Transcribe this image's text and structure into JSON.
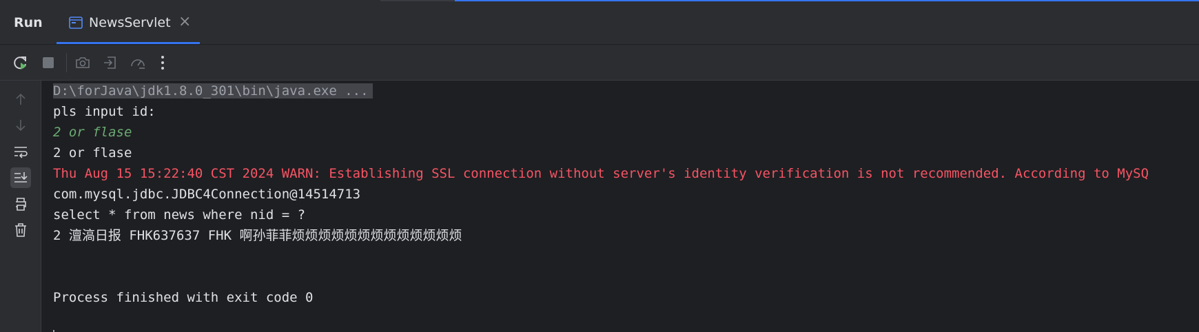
{
  "window": {
    "panel_title": "Run",
    "tab_label": "NewsServlet",
    "tab_close_glyph": "×"
  },
  "toolbar": {
    "buttons": [
      "rerun-icon",
      "stop-icon",
      "camera-icon",
      "exit-icon",
      "profiler-icon",
      "more-icon"
    ]
  },
  "gutter": {
    "buttons": [
      "arrow-up-icon",
      "arrow-down-icon",
      "soft-wrap-icon",
      "scroll-to-end-icon",
      "print-icon",
      "trash-icon"
    ]
  },
  "console": {
    "command": "D:\\forJava\\jdk1.8.0_301\\bin\\java.exe ...",
    "prompt": "pls input id:",
    "user_input": "2 or flase",
    "echo": "2 or flase",
    "warning": "Thu Aug 15 15:22:40 CST 2024 WARN: Establishing SSL connection without server's identity verification is not recommended. According to MySQ",
    "connection": "com.mysql.jdbc.JDBC4Connection@14514713",
    "query": "select * from news where nid = ?",
    "result": "2 澶滈日报 FHK637637 FHK 啊孙菲菲烦烦烦烦烦烦烦烦烦烦烦烦烦",
    "exit": "Process finished with exit code 0"
  },
  "colors": {
    "accent": "#3574f0",
    "warn": "#f75464",
    "input": "#6aab73",
    "background": "#1e1f22",
    "panel": "#2b2d30"
  }
}
